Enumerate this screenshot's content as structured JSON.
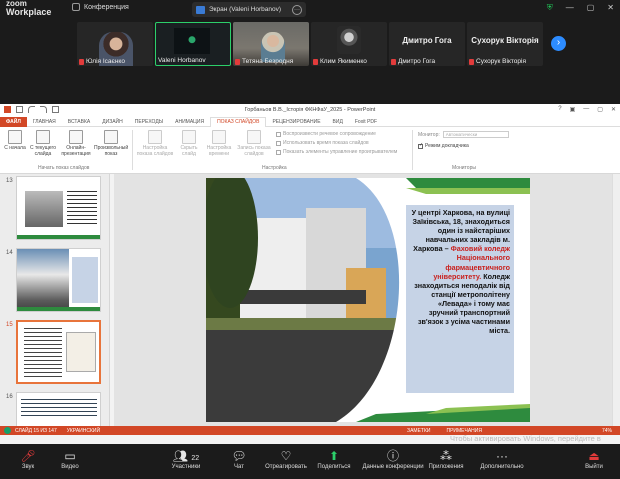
{
  "zoom": {
    "brand_line1": "zoom",
    "brand_line2": "Workplace",
    "conference_label": "Конференция",
    "share_label": "Экран (Valeni Horbanov)",
    "participants": [
      {
        "name": "Юлія Ісаєнко"
      },
      {
        "name": "Valeni Horbanov"
      },
      {
        "name": "Тетяна Безродня"
      },
      {
        "name": "Клим Якименко"
      },
      {
        "name": "Дмитро Гога",
        "big": "Дмитро Гога"
      },
      {
        "name": "Сухорук Вікторія",
        "big": "Сухорук Вікторія"
      }
    ],
    "toolbar": {
      "audio": "Звук",
      "video": "Видео",
      "participants": "Участники",
      "participants_count": "22",
      "chat": "Чат",
      "react": "Отреагировать",
      "share": "Поделиться",
      "conf_data": "Данные конференции",
      "apps": "Приложения",
      "more": "Дополнительно",
      "leave": "Выйти"
    },
    "activate_windows": "Чтобы активировать Windows, перейдите в раздел \"Параметры\"."
  },
  "ppt": {
    "title": "Горбаньов В.В._Історія ФКНФаУ_2025 - PowerPoint",
    "tabs": [
      "ФАЙЛ",
      "ГЛАВНАЯ",
      "ВСТАВКА",
      "ДИЗАЙН",
      "ПЕРЕХОДЫ",
      "АНИМАЦИЯ",
      "ПОКАЗ СЛАЙДОВ",
      "РЕЦЕНЗИРОВАНИЕ",
      "ВИД",
      "Foxit PDF"
    ],
    "ribbon": {
      "btn_from_start": "С начала",
      "btn_from_current": "С текущего слайда",
      "btn_online": "Онлайн-презентация",
      "btn_custom": "Произвольный показ",
      "btn_setup": "Настройка показа слайдов",
      "btn_hide": "Скрыть слайд",
      "btn_rehearse": "Настройка времени",
      "btn_record": "Запись показа слайдов",
      "chk_narration": "Воспроизвести речевое сопровождение",
      "chk_timings": "Использовать время показа слайдов",
      "chk_controls": "Показать элементы управление проигрывателем",
      "monitor_label": "Монитор:",
      "monitor_value": "Автоматически",
      "chk_presenter": "Режим докладчика",
      "group_start": "Начать показ слайдов",
      "group_setup": "Настройка",
      "group_monitors": "Мониторы"
    },
    "thumb_numbers": [
      "13",
      "14",
      "15",
      "16"
    ],
    "slide_text_1": "У центрі Харкова, на вулиці Заїківська, 18, знаходиться один із найстаріших навчальних закладів м. Харкова –",
    "slide_text_red": "Фаховий коледж Національного фармацевтичного університету.",
    "slide_text_2": "Коледж знаходиться неподалік від станції метрополітену «Левада» і тому має зручний транспортний зв'язок з усіма частинами міста.",
    "status": {
      "slide_of": "СЛАЙД 15 ИЗ 147",
      "language": "УКРАИНСКИЙ",
      "notes": "ЗАМЕТКИ",
      "comments": "ПРИМЕЧАНИЯ",
      "zoom": "74%"
    }
  }
}
